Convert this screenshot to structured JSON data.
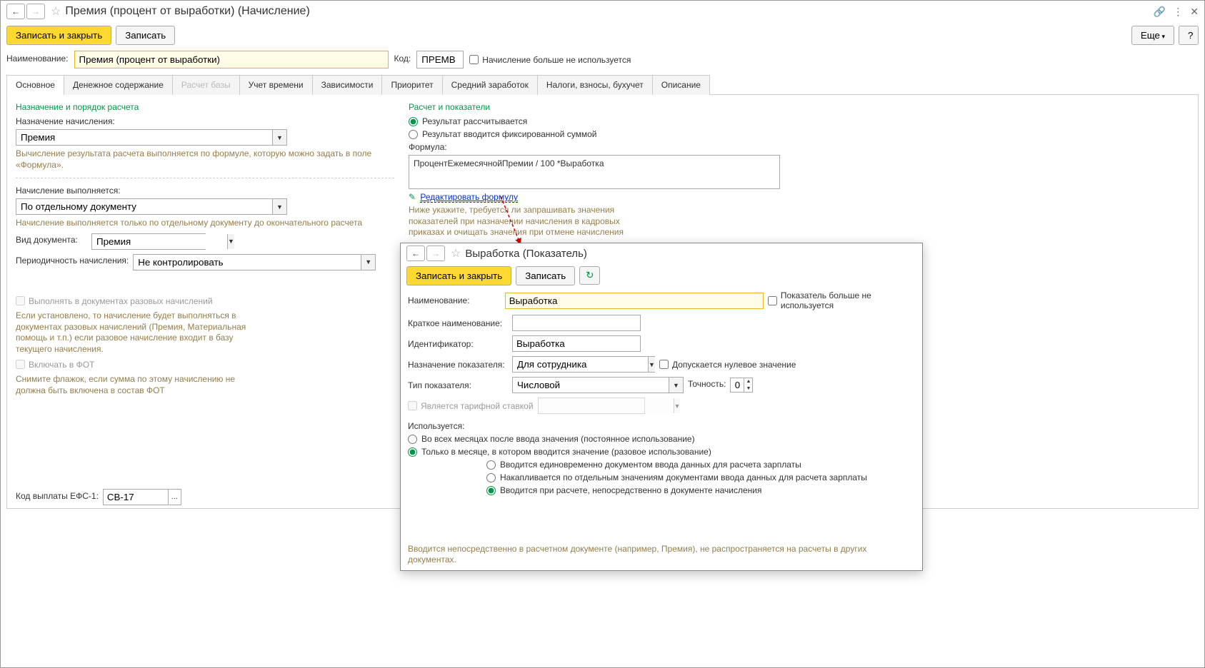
{
  "main_window": {
    "title": "Премия (процент от выработки) (Начисление)",
    "toolbar": {
      "save_close": "Записать и закрыть",
      "save": "Записать",
      "more": "Еще",
      "help": "?"
    },
    "name_label": "Наименование:",
    "name_value": "Премия (процент от выработки)",
    "code_label": "Код:",
    "code_value": "ПРЕМВ",
    "not_used_label": "Начисление больше не используется",
    "tabs": [
      "Основное",
      "Денежное содержание",
      "Расчет базы",
      "Учет времени",
      "Зависимости",
      "Приоритет",
      "Средний заработок",
      "Налоги, взносы, бухучет",
      "Описание"
    ],
    "left": {
      "section_a": "Назначение и порядок расчета",
      "purpose_label": "Назначение начисления:",
      "purpose_value": "Премия",
      "hint_formula": "Вычисление результата расчета выполняется по формуле, которую можно задать в поле «Формула».",
      "exec_label": "Начисление выполняется:",
      "exec_value": "По отдельному документу",
      "hint_exec": "Начисление выполняется только по отдельному документу до окончательного расчета",
      "doc_type_label": "Вид документа:",
      "doc_type_value": "Премия",
      "period_label": "Периодичность начисления:",
      "period_value": "Не контролировать",
      "cb_one_time": "Выполнять в документах разовых начислений",
      "hint_one_time": "Если установлено, то начисление будет выполняться в документах разовых начислений (Премия, Материальная помощь и т.п.) если разовое начисление входит в базу текущего начисления.",
      "cb_fot": "Включать в ФОТ",
      "hint_fot": "Снимите флажок, если сумма по этому начислению не должна быть включена в состав ФОТ",
      "efs_label": "Код выплаты ЕФС-1:",
      "efs_value": "СВ-17"
    },
    "right": {
      "section_b": "Расчет и показатели",
      "radio_calc": "Результат рассчитывается",
      "radio_fixed": "Результат вводится фиксированной суммой",
      "formula_label": "Формула:",
      "formula_value": "ПроцентЕжемесячнойПремии / 100 *Выработка",
      "edit_formula": "Редактировать формулу",
      "hint_below": "Ниже укажите, требуется ли запрашивать значения показателей при назначении начисления в кадровых приказах и очищать значения при отмене начисления"
    }
  },
  "popup": {
    "title": "Выработка (Показатель)",
    "toolbar": {
      "save_close": "Записать и закрыть",
      "save": "Записать"
    },
    "name_label": "Наименование:",
    "name_value": "Выработка",
    "not_used_label": "Показатель больше не используется",
    "short_label": "Краткое наименование:",
    "short_value": "",
    "id_label": "Идентификатор:",
    "id_value": "Выработка",
    "purpose_label": "Назначение показателя:",
    "purpose_value": "Для сотрудника",
    "allow_zero": "Допускается нулевое значение",
    "type_label": "Тип показателя:",
    "type_value": "Числовой",
    "precision_label": "Точность:",
    "precision_value": "0",
    "is_tariff": "Является тарифной ставкой",
    "used_label": "Используется:",
    "used_opt1": "Во всех месяцах после ввода значения (постоянное использование)",
    "used_opt2": "Только в месяце, в котором вводится значение (разовое использование)",
    "sub_opt1": "Вводится единовременно документом ввода данных для расчета зарплаты",
    "sub_opt2": "Накапливается по отдельным значениям документами ввода данных для расчета зарплаты",
    "sub_opt3": "Вводится при расчете, непосредственно в документе начисления",
    "hint_bottom": "Вводится непосредственно в расчетном документе (например, Премия), не распространяется на расчеты в других документах."
  }
}
